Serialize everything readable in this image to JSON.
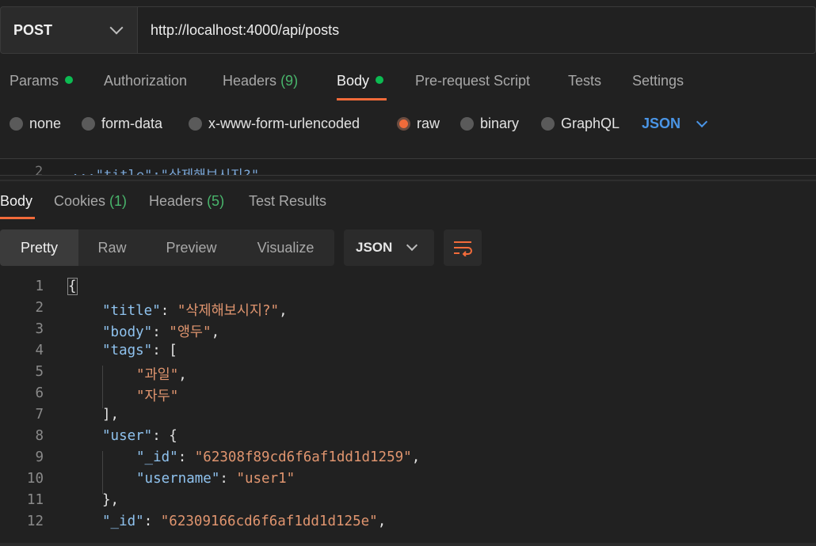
{
  "request": {
    "method": "POST",
    "url": "http://localhost:4000/api/posts"
  },
  "request_tabs": {
    "params": "Params",
    "authorization": "Authorization",
    "headers": "Headers",
    "headers_count": "(9)",
    "body": "Body",
    "prerequest": "Pre-request Script",
    "tests": "Tests",
    "settings": "Settings"
  },
  "body_types": {
    "none": "none",
    "form_data": "form-data",
    "urlencoded": "x-www-form-urlencoded",
    "raw": "raw",
    "binary": "binary",
    "graphql": "GraphQL",
    "selected": "raw",
    "format": "JSON"
  },
  "editor_strip": {
    "line": "2",
    "text": "···\"title\":\"삭제해보시지?\""
  },
  "response_tabs": {
    "body": "Body",
    "cookies": "Cookies",
    "cookies_count": "(1)",
    "headers": "Headers",
    "headers_count": "(5)",
    "test_results": "Test Results"
  },
  "view_modes": {
    "pretty": "Pretty",
    "raw": "Raw",
    "preview": "Preview",
    "visualize": "Visualize",
    "format": "JSON"
  },
  "code_lines": [
    {
      "n": "1",
      "key": "",
      "sep": "{",
      "val": "",
      "end": "",
      "indent": 0
    },
    {
      "n": "2",
      "key": "\"title\"",
      "sep": ": ",
      "val": "\"삭제해보시지?\"",
      "end": ",",
      "indent": 1
    },
    {
      "n": "3",
      "key": "\"body\"",
      "sep": ": ",
      "val": "\"앵두\"",
      "end": ",",
      "indent": 1
    },
    {
      "n": "4",
      "key": "\"tags\"",
      "sep": ": [",
      "val": "",
      "end": "",
      "indent": 1
    },
    {
      "n": "5",
      "key": "",
      "sep": "",
      "val": "\"과일\"",
      "end": ",",
      "indent": 2
    },
    {
      "n": "6",
      "key": "",
      "sep": "",
      "val": "\"자두\"",
      "end": "",
      "indent": 2
    },
    {
      "n": "7",
      "key": "",
      "sep": "],",
      "val": "",
      "end": "",
      "indent": 1
    },
    {
      "n": "8",
      "key": "\"user\"",
      "sep": ": {",
      "val": "",
      "end": "",
      "indent": 1
    },
    {
      "n": "9",
      "key": "\"_id\"",
      "sep": ": ",
      "val": "\"62308f89cd6f6af1dd1d1259\"",
      "end": ",",
      "indent": 2
    },
    {
      "n": "10",
      "key": "\"username\"",
      "sep": ": ",
      "val": "\"user1\"",
      "end": "",
      "indent": 2
    },
    {
      "n": "11",
      "key": "",
      "sep": "},",
      "val": "",
      "end": "",
      "indent": 1
    },
    {
      "n": "12",
      "key": "\"_id\"",
      "sep": ": ",
      "val": "\"62309166cd6f6af1dd1d125e\"",
      "end": ",",
      "indent": 1
    }
  ],
  "colors": {
    "accent": "#f26b3a",
    "status_dot": "#0cbb52",
    "json_key": "#8fc2ee",
    "json_string": "#e0956f",
    "link_blue": "#4a95e6"
  }
}
